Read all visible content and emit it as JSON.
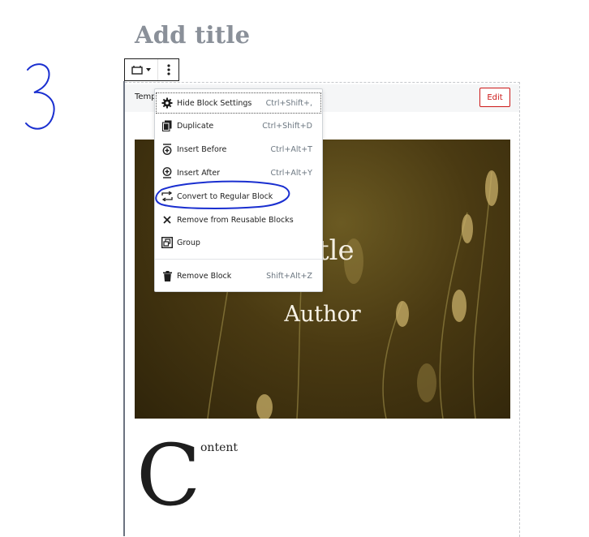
{
  "annotation": {
    "text": "3",
    "color": "#1a2fd0"
  },
  "editor": {
    "post_title_placeholder": "Add title"
  },
  "reusable_block": {
    "label": "Template",
    "edit_button": "Edit"
  },
  "cover": {
    "title": "Title",
    "author": "Author"
  },
  "paragraph": {
    "dropcap": "C",
    "text": "ontent"
  },
  "block_menu": {
    "items": [
      {
        "label": "Hide Block Settings",
        "shortcut": "Ctrl+Shift+,",
        "icon": "gear-icon"
      },
      {
        "label": "Duplicate",
        "shortcut": "Ctrl+Shift+D",
        "icon": "copy-icon"
      },
      {
        "label": "Insert Before",
        "shortcut": "Ctrl+Alt+T",
        "icon": "insert-before-icon"
      },
      {
        "label": "Insert After",
        "shortcut": "Ctrl+Alt+Y",
        "icon": "insert-after-icon"
      },
      {
        "label": "Convert to Regular Block",
        "shortcut": "",
        "icon": "convert-icon"
      },
      {
        "label": "Remove from Reusable Blocks",
        "shortcut": "",
        "icon": "close-icon"
      },
      {
        "label": "Group",
        "shortcut": "",
        "icon": "group-icon"
      },
      {
        "label": "Remove Block",
        "shortcut": "Shift+Alt+Z",
        "icon": "trash-icon"
      }
    ]
  },
  "colors": {
    "accent_red": "#cc1818",
    "annotation_blue": "#1a2fd0"
  }
}
